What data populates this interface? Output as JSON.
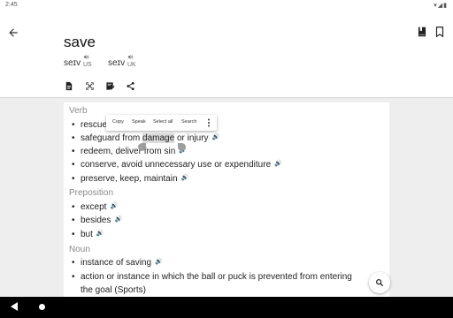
{
  "status_bar": {
    "time": "2:45",
    "icons": "▾◢▮"
  },
  "header": {
    "word": "save",
    "pronunciations": [
      {
        "ipa": "seɪv",
        "region": "US"
      },
      {
        "ipa": "seɪv",
        "region": "UK"
      }
    ]
  },
  "icons": {
    "back": "arrow-back-icon",
    "toolbar": [
      "bookmark-book-icon",
      "bookmark-outline-icon"
    ],
    "actions": [
      "document-icon",
      "fullscreen-icon",
      "edit-note-icon",
      "share-icon"
    ],
    "speaker": "speaker-icon",
    "fab": "search-icon"
  },
  "context_menu": [
    "Copy",
    "Speak",
    "Select all",
    "Search"
  ],
  "sections": {
    "verb": {
      "title": "Verb",
      "items": [
        {
          "text": "rescue"
        },
        {
          "pre": "safeguard from ",
          "highlight": "damage",
          "post": " or injury"
        },
        {
          "text": "redeem, deliver from sin"
        },
        {
          "text": "conserve, avoid unnecessary use or expenditure"
        },
        {
          "text": "preserve, keep, maintain"
        }
      ]
    },
    "preposition": {
      "title": "Preposition",
      "items": [
        {
          "text": "except"
        },
        {
          "text": "besides"
        },
        {
          "text": "but"
        }
      ]
    },
    "noun": {
      "title": "Noun",
      "items": [
        {
          "text": "instance of saving"
        },
        {
          "text": "action or instance in which the ball or puck is prevented from entering",
          "cont": "the goal (Sports)"
        }
      ]
    }
  },
  "colors": {
    "content_bg": "#eeeeee",
    "card": "#ffffff",
    "section_title": "#8a8a8a",
    "nav_bar": "#000000"
  }
}
